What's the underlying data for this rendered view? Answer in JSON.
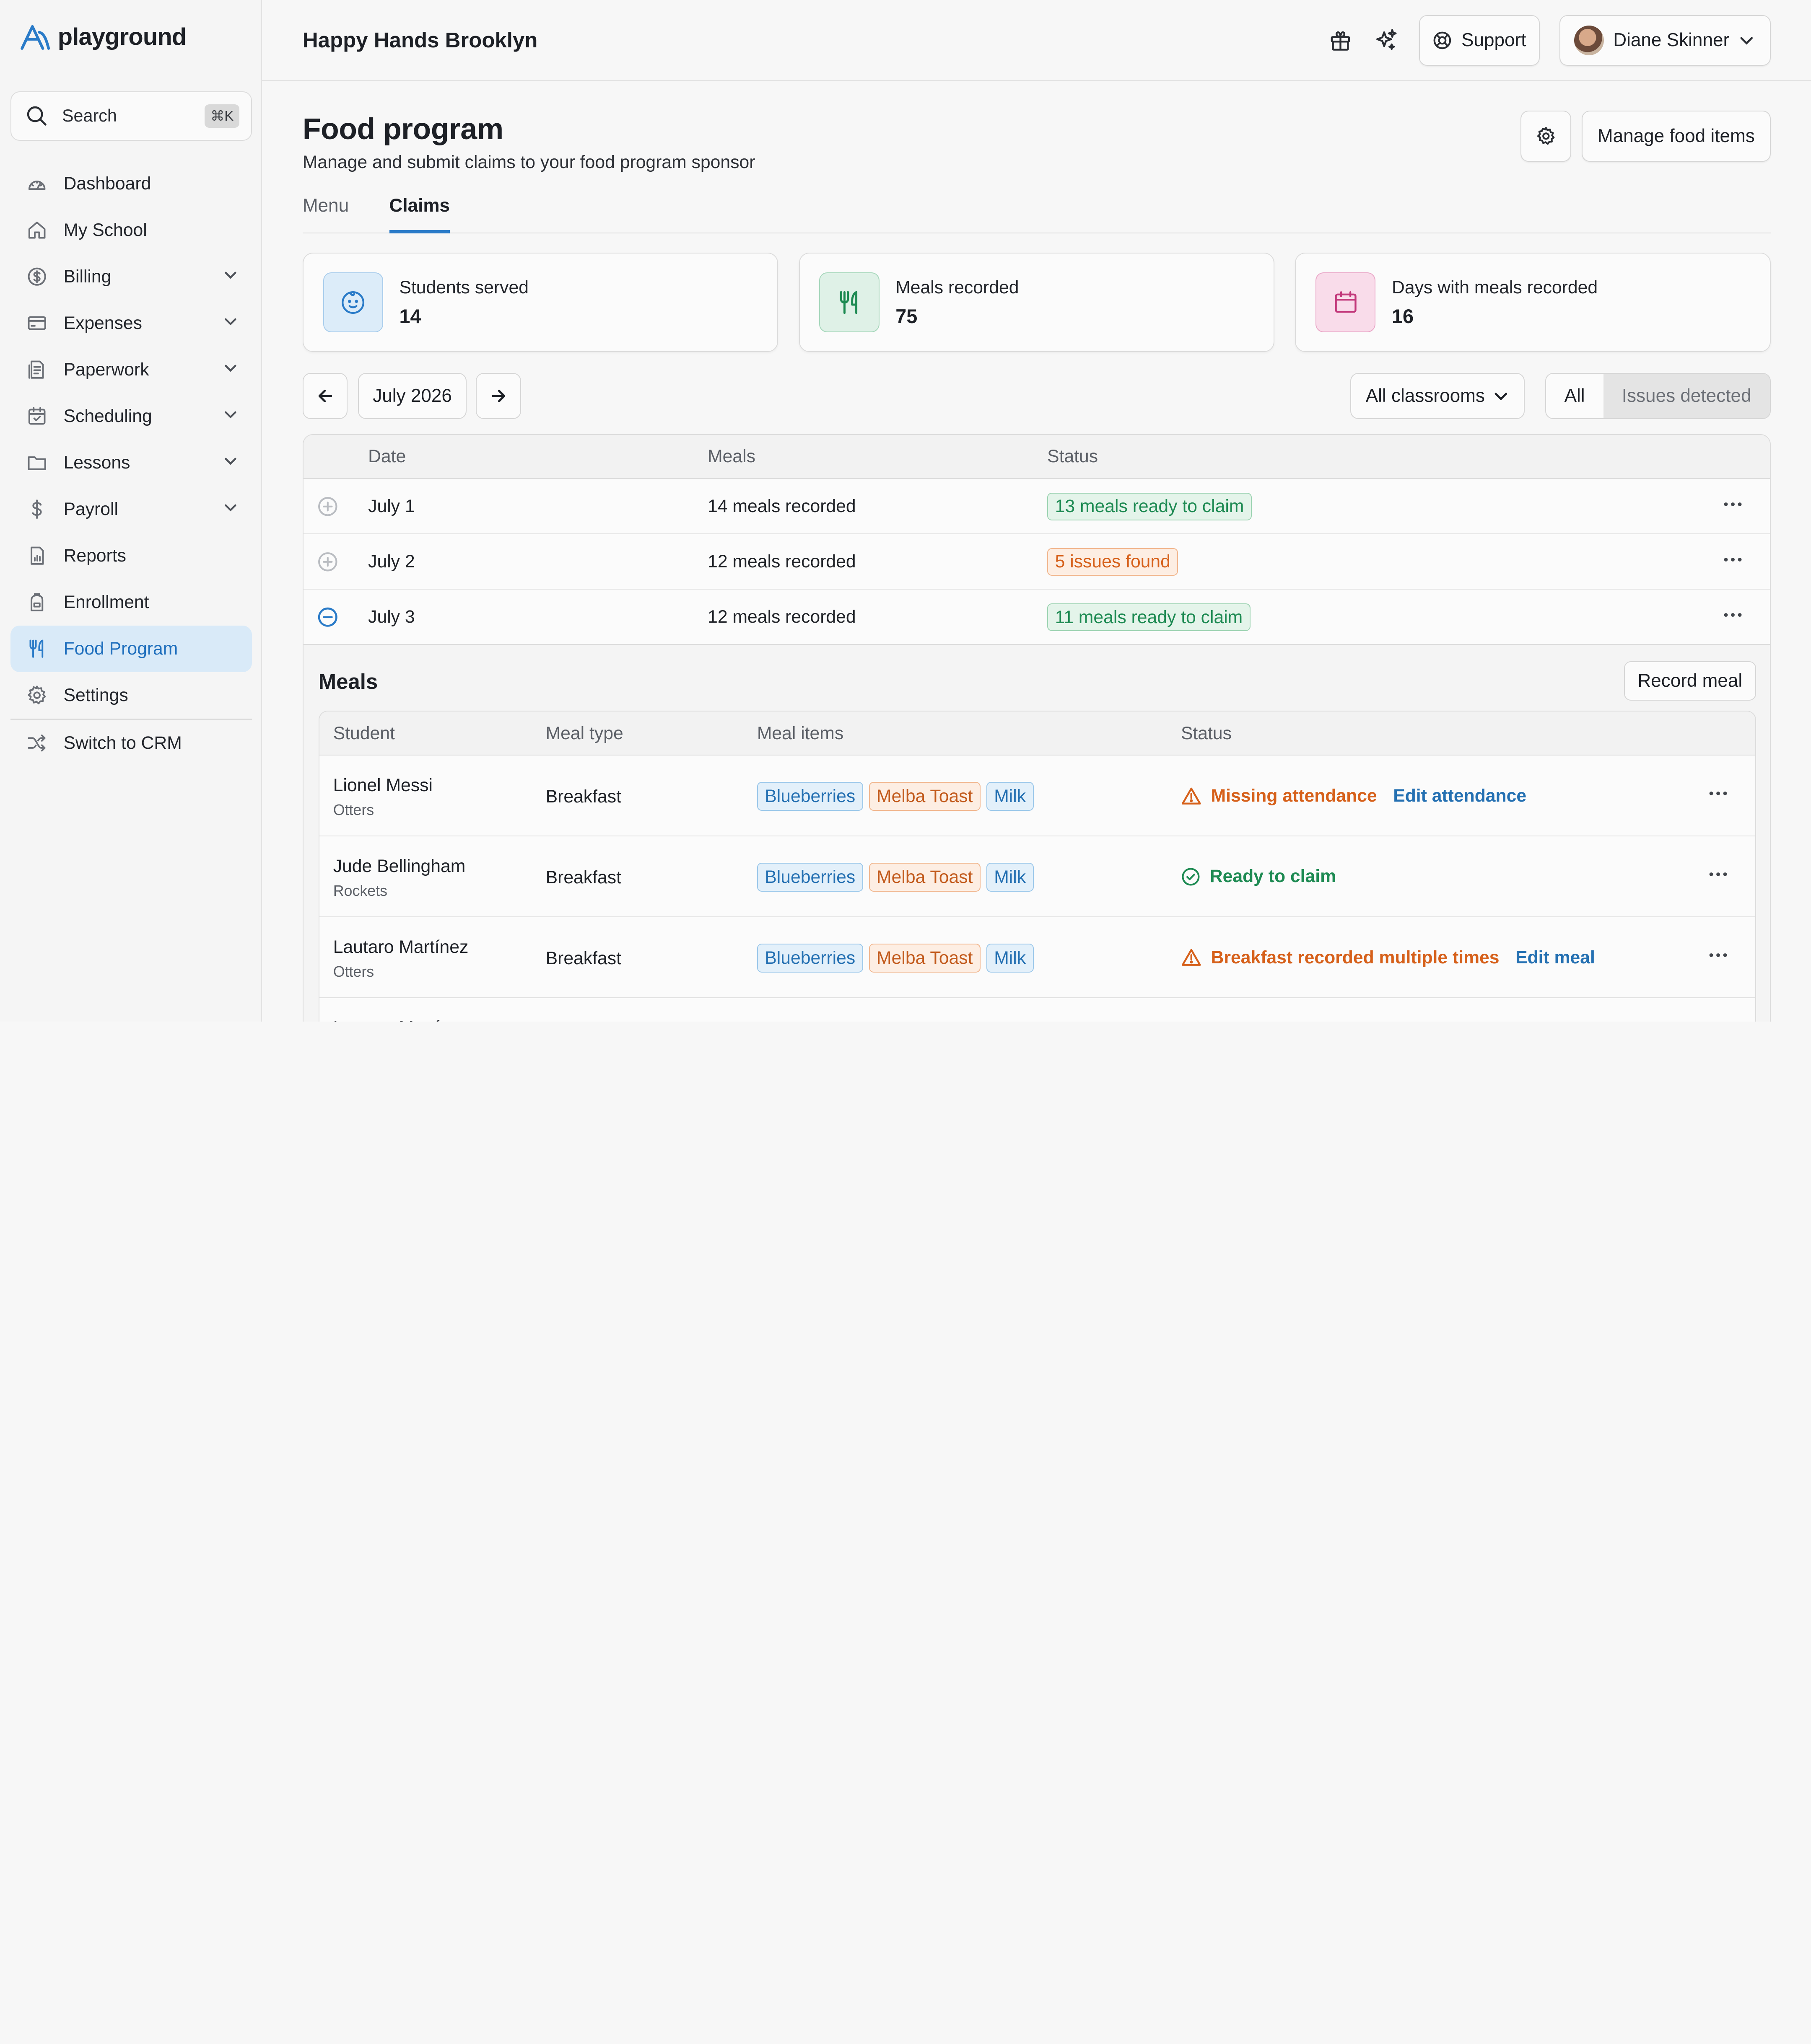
{
  "brand": {
    "name": "playground"
  },
  "search": {
    "label": "Search",
    "shortcut": "⌘K"
  },
  "nav": {
    "items": [
      {
        "label": "Dashboard",
        "icon": "dashboard-icon",
        "chevron": false,
        "active": false
      },
      {
        "label": "My School",
        "icon": "home-icon",
        "chevron": false,
        "active": false
      },
      {
        "label": "Billing",
        "icon": "dollar-circle-icon",
        "chevron": true,
        "active": false
      },
      {
        "label": "Expenses",
        "icon": "card-icon",
        "chevron": true,
        "active": false
      },
      {
        "label": "Paperwork",
        "icon": "document-icon",
        "chevron": true,
        "active": false
      },
      {
        "label": "Scheduling",
        "icon": "calendar-check-icon",
        "chevron": true,
        "active": false
      },
      {
        "label": "Lessons",
        "icon": "folder-icon",
        "chevron": true,
        "active": false
      },
      {
        "label": "Payroll",
        "icon": "dollar-icon",
        "chevron": true,
        "active": false
      },
      {
        "label": "Reports",
        "icon": "report-icon",
        "chevron": false,
        "active": false
      },
      {
        "label": "Enrollment",
        "icon": "backpack-icon",
        "chevron": false,
        "active": false
      },
      {
        "label": "Food Program",
        "icon": "utensils-icon",
        "chevron": false,
        "active": true
      },
      {
        "label": "Settings",
        "icon": "gear-icon",
        "chevron": false,
        "active": false
      }
    ],
    "switch_label": "Switch to CRM"
  },
  "topbar": {
    "school": "Happy Hands Brooklyn",
    "support_label": "Support",
    "user_name": "Diane Skinner"
  },
  "page": {
    "title": "Food program",
    "subtitle": "Manage and submit claims to your food program sponsor",
    "manage_label": "Manage food items"
  },
  "tabs": [
    {
      "label": "Menu",
      "active": false
    },
    {
      "label": "Claims",
      "active": true
    }
  ],
  "stats": [
    {
      "label": "Students served",
      "value": "14",
      "icon": "baby-face-icon",
      "bg": "#dcecf9",
      "border": "#a9cdec",
      "fg": "#2a7bc8"
    },
    {
      "label": "Meals recorded",
      "value": "75",
      "icon": "utensils-icon",
      "bg": "#dff1e7",
      "border": "#a6d7bb",
      "fg": "#1d8a52"
    },
    {
      "label": "Days with meals recorded",
      "value": "16",
      "icon": "calendar-icon",
      "bg": "#f9dcea",
      "border": "#eaa8c8",
      "fg": "#c2387a"
    }
  ],
  "filters": {
    "month": "July 2026",
    "classroom": "All classrooms",
    "seg_all": "All",
    "seg_issues": "Issues detected"
  },
  "claims_table": {
    "headers": {
      "date": "Date",
      "meals": "Meals",
      "status": "Status"
    },
    "rows": [
      {
        "date": "July 1",
        "meals": "14 meals recorded",
        "status": "13 meals ready to claim",
        "tone": "green",
        "expanded": false
      },
      {
        "date": "July 2",
        "meals": "12 meals recorded",
        "status": "5 issues found",
        "tone": "orange",
        "expanded": false
      },
      {
        "date": "July 3",
        "meals": "12 meals recorded",
        "status": "11 meals ready to claim",
        "tone": "green",
        "expanded": true
      }
    ]
  },
  "meals_panel": {
    "title": "Meals",
    "record_label": "Record meal",
    "headers": {
      "student": "Student",
      "meal_type": "Meal type",
      "meal_items": "Meal items",
      "status": "Status"
    },
    "rows": [
      {
        "student": "Lionel Messi",
        "classroom": "Otters",
        "meal_type": "Breakfast",
        "items": [
          {
            "label": "Blueberries",
            "tone": "blue"
          },
          {
            "label": "Melba Toast",
            "tone": "peach"
          },
          {
            "label": "Milk",
            "tone": "blue"
          }
        ],
        "status": "Missing attendance",
        "status_tone": "warn",
        "action": "Edit attendance"
      },
      {
        "student": "Jude Bellingham",
        "classroom": "Rockets",
        "meal_type": "Breakfast",
        "items": [
          {
            "label": "Blueberries",
            "tone": "blue"
          },
          {
            "label": "Melba Toast",
            "tone": "peach"
          },
          {
            "label": "Milk",
            "tone": "blue"
          }
        ],
        "status": "Ready to claim",
        "status_tone": "ok",
        "action": ""
      },
      {
        "student": "Lautaro Martínez",
        "classroom": "Otters",
        "meal_type": "Breakfast",
        "items": [
          {
            "label": "Blueberries",
            "tone": "blue"
          },
          {
            "label": "Melba Toast",
            "tone": "peach"
          },
          {
            "label": "Milk",
            "tone": "blue"
          }
        ],
        "status": "Breakfast recorded multiple times",
        "status_tone": "warn",
        "action": "Edit meal"
      },
      {
        "student": "Lautaro Martínez",
        "classroom": "",
        "meal_type": "",
        "items": [],
        "status": "",
        "status_tone": "",
        "action": ""
      }
    ]
  }
}
